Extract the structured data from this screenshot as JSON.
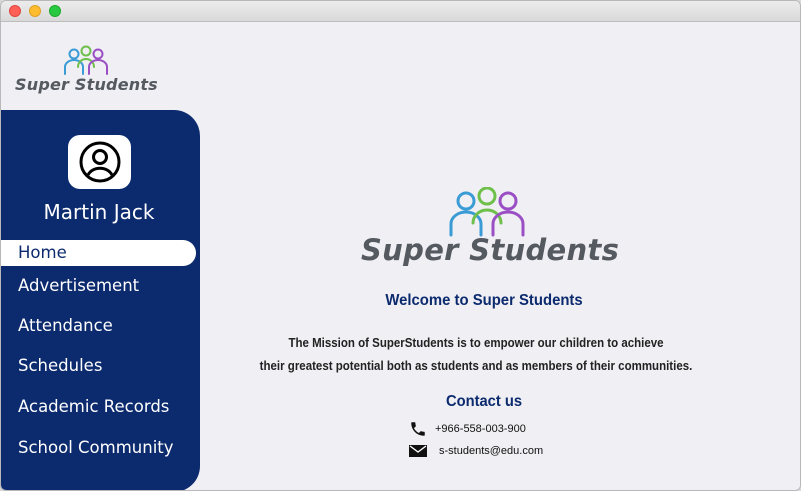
{
  "brand": {
    "name": "Super Students"
  },
  "user": {
    "name": "Martin Jack"
  },
  "sidebar": {
    "items": [
      {
        "label": "Home",
        "active": true
      },
      {
        "label": "Advertisement"
      },
      {
        "label": "Attendance"
      },
      {
        "label": "Schedules"
      },
      {
        "label": "Academic Records"
      },
      {
        "label": "School Community"
      }
    ]
  },
  "main": {
    "welcome": "Welcome to Super Students",
    "mission_line1": "The Mission of SuperStudents is to empower our children to achieve",
    "mission_line2": "their greatest potential both as students and as members of their communities.",
    "contact_title": "Contact us",
    "phone": "+966-558-003-900",
    "email": "s-students@edu.com"
  },
  "colors": {
    "sidebar": "#0c2a6e",
    "heading": "#0c2a6e",
    "logo_text": "#555a60",
    "figure_blue": "#3a9bd5",
    "figure_green": "#6fbf4b",
    "figure_purple": "#9b4fc4"
  },
  "icons": [
    "person-icon",
    "phone-icon",
    "mail-icon",
    "students-logo-icon"
  ]
}
